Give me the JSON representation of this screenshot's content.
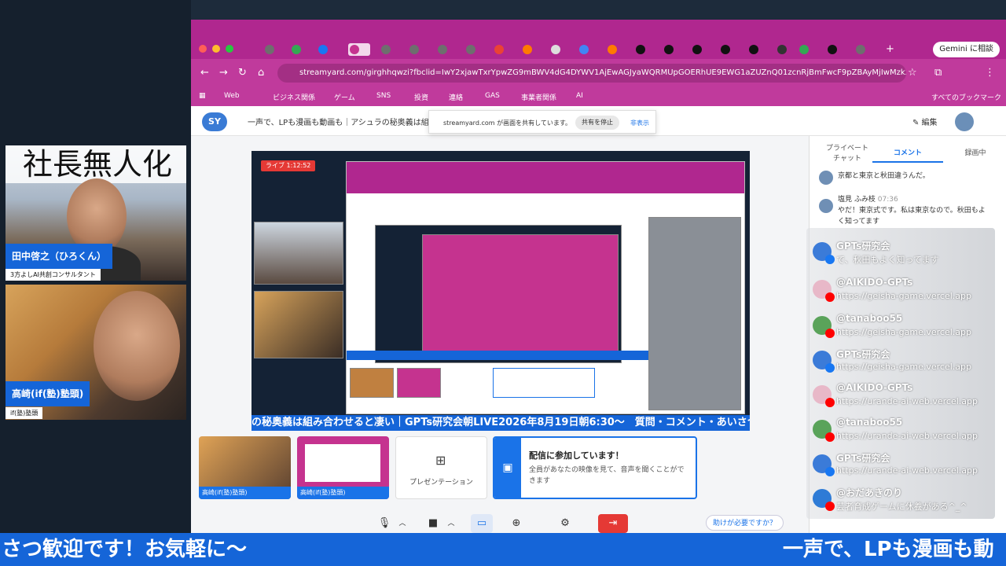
{
  "speakers": [
    {
      "name": "田中啓之（ひろくん）",
      "subtitle": "3方よしAI共創コンサルタント",
      "banner": "社長無人化"
    },
    {
      "name": "高崎(if(塾)塾頭)",
      "subtitle": "if(塾)塾頭"
    }
  ],
  "browser": {
    "url": "streamyard.com/girghhqwzi?fbclid=IwY2xjawTxrYpwZG9mBWV4dG4DYWV1AjEwAGJyaWQRMUpGOERhUE9EWG1aZUZnQ01zcnRjBmFwcF9pZBAyMjIwMzkxNzg4M...",
    "gemini_button": "Gemini に相談",
    "bookmarks": [
      "Web",
      "ビジネス関係",
      "ゲーム",
      "SNS",
      "投資",
      "連絡",
      "GAS",
      "事業者関係",
      "AI"
    ],
    "all_bookmarks": "すべてのブックマーク"
  },
  "app": {
    "logo": "SY",
    "title": "一声で、LPも漫画も動画も｜アシュラの秘奥義は組み合わせると凄い",
    "share_notice": "streamyard.com が画面を共有しています。",
    "stop_share": "共有を停止",
    "hide": "非表示",
    "edit": "✎ 編集",
    "live_badge": "ライブ 1:12:52",
    "stage_ticker": "の秘奥義は組み合わせると凄い｜GPTs研究会朝LIVE2026年8月19日朝6:30〜　質問・コメント・あいさつ歓迎です！",
    "tiles": [
      {
        "label": "高崎(if(塾)塾頭)"
      },
      {
        "label": "高崎(if(塾)塾頭)"
      },
      {
        "label": "プレゼンテーション"
      }
    ],
    "join_card": {
      "title": "配信に参加しています！",
      "body": "全員があなたの映像を見て、音声を聞くことができます"
    },
    "help": "助けが必要ですか？"
  },
  "side": {
    "tabs": [
      "プライベートチャット",
      "コメント",
      "録画中"
    ],
    "messages": [
      {
        "text": "京都と東京と秋田違うんだ。"
      },
      {
        "name": "塩見 ふみ枝",
        "time": "07:36",
        "text": "やだ！東京式です。私は東京なので。秋田もよく知ってます"
      }
    ]
  },
  "chat": [
    {
      "name": "GPTs研究会",
      "text": "で、秋田もよく知ってます",
      "color": "#3b7bd8",
      "badge": "fb"
    },
    {
      "name": "@AIKIDO-GPTs",
      "text": "https://geisha-game.vercel.app",
      "color": "#e8b8c8",
      "badge": "yt"
    },
    {
      "name": "@tanaboo55",
      "text": "https://geisha-game.vercel.app",
      "color": "#5aa35a",
      "badge": "yt"
    },
    {
      "name": "GPTs研究会",
      "text": "https://geisha-game.vercel.app",
      "color": "#3b7bd8",
      "badge": "fb"
    },
    {
      "name": "@AIKIDO-GPTs",
      "text": "https://urande-ai-web.vercel.app",
      "color": "#e8b8c8",
      "badge": "yt"
    },
    {
      "name": "@tanaboo55",
      "text": "https://urande-ai-web.vercel.app",
      "color": "#5aa35a",
      "badge": "yt"
    },
    {
      "name": "GPTs研究会",
      "text": "https://urande-ai-web.vercel.app",
      "color": "#3b7bd8",
      "badge": "fb"
    },
    {
      "name": "@おだあきのり",
      "text": "芸者育成ゲームに休養がある^_^",
      "color": "#2e7bd6",
      "badge": "yt"
    }
  ],
  "ticker": {
    "left": "さつ歓迎です！お気軽に〜",
    "right": "一声で、LPも漫画も動"
  }
}
